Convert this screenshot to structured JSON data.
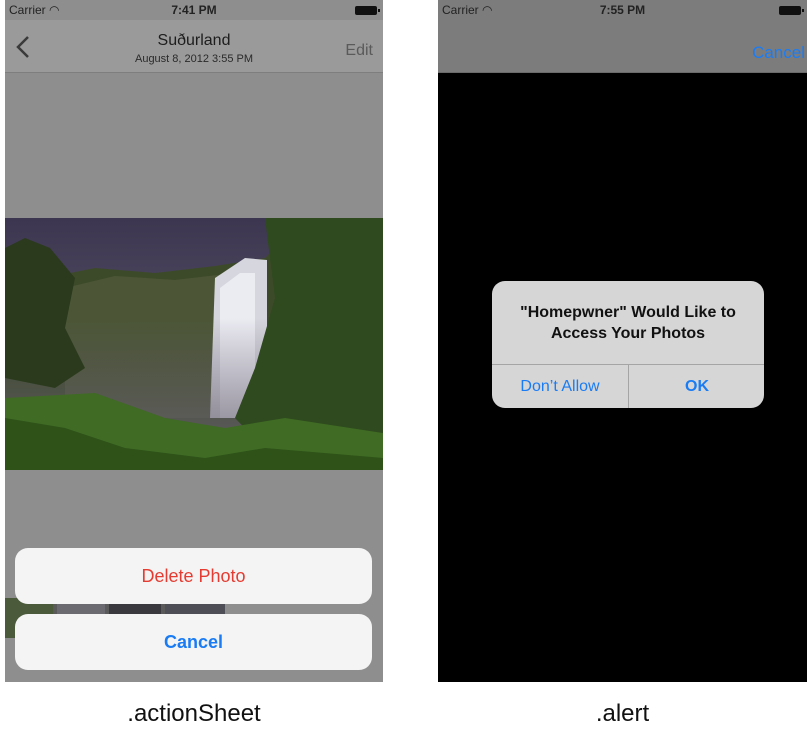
{
  "left": {
    "status": {
      "carrier": "Carrier",
      "time": "7:41 PM"
    },
    "nav": {
      "title": "Suðurland",
      "subtitle": "August 8, 2012  3:55 PM",
      "edit": "Edit"
    },
    "sheet": {
      "delete": "Delete Photo",
      "cancel": "Cancel"
    },
    "caption": ".actionSheet"
  },
  "right": {
    "status": {
      "carrier": "Carrier",
      "time": "7:55 PM"
    },
    "nav": {
      "cancel": "Cancel"
    },
    "alert": {
      "title_line1": "\"Homepwner\" Would Like to",
      "title_line2": "Access Your Photos",
      "dont_allow": "Don’t Allow",
      "ok": "OK"
    },
    "caption": ".alert"
  },
  "colors": {
    "accent": "#1a7cf5",
    "destructive": "#e53b30",
    "dim": "#8e8e8e"
  },
  "icons": [
    "wifi-icon",
    "battery-icon",
    "back-chevron-icon"
  ]
}
